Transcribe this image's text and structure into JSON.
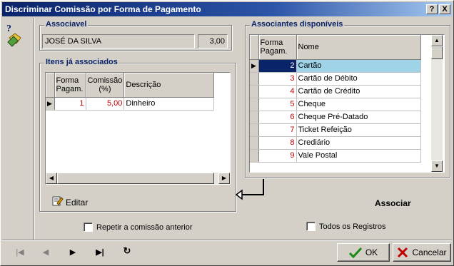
{
  "window": {
    "title": "Discriminar Comissão por Forma de Pagamento",
    "help_label": "?",
    "close_label": "X"
  },
  "associavel": {
    "label": "Associavel",
    "name": "JOSÉ DA SILVA",
    "value": "3,00"
  },
  "itens": {
    "label": "Itens já associados",
    "columns": [
      "Forma Pagam.",
      "Comissão (%)",
      "Descrição"
    ],
    "rows": [
      {
        "forma": "1",
        "comissao": "5,00",
        "descricao": "Dinheiro"
      }
    ],
    "editar_label": "Editar"
  },
  "disponiveis": {
    "label": "Associantes disponíveis",
    "columns": [
      "Forma Pagam.",
      "Nome"
    ],
    "rows": [
      {
        "forma": "2",
        "nome": "Cartão"
      },
      {
        "forma": "3",
        "nome": "Cartão de Débito"
      },
      {
        "forma": "4",
        "nome": "Cartão de Crédito"
      },
      {
        "forma": "5",
        "nome": "Cheque"
      },
      {
        "forma": "6",
        "nome": "Cheque Pré-Datado"
      },
      {
        "forma": "7",
        "nome": "Ticket Refeição"
      },
      {
        "forma": "8",
        "nome": "Crediário"
      },
      {
        "forma": "9",
        "nome": "Vale Postal"
      }
    ]
  },
  "associar_label": "Associar",
  "repetir_label": "Repetir a comissão anterior",
  "todos_label": "Todos os Registros",
  "ok_label": "OK",
  "cancelar_label": "Cancelar",
  "nav": {
    "first": "|◀",
    "prev": "◀",
    "next": "▶",
    "last": "▶|",
    "refresh": "↻"
  },
  "colors": {
    "title_bar": "#0a246a",
    "group_label": "#0a246a",
    "selected_row": "#9fd3e8",
    "number_red": "#c00000"
  }
}
